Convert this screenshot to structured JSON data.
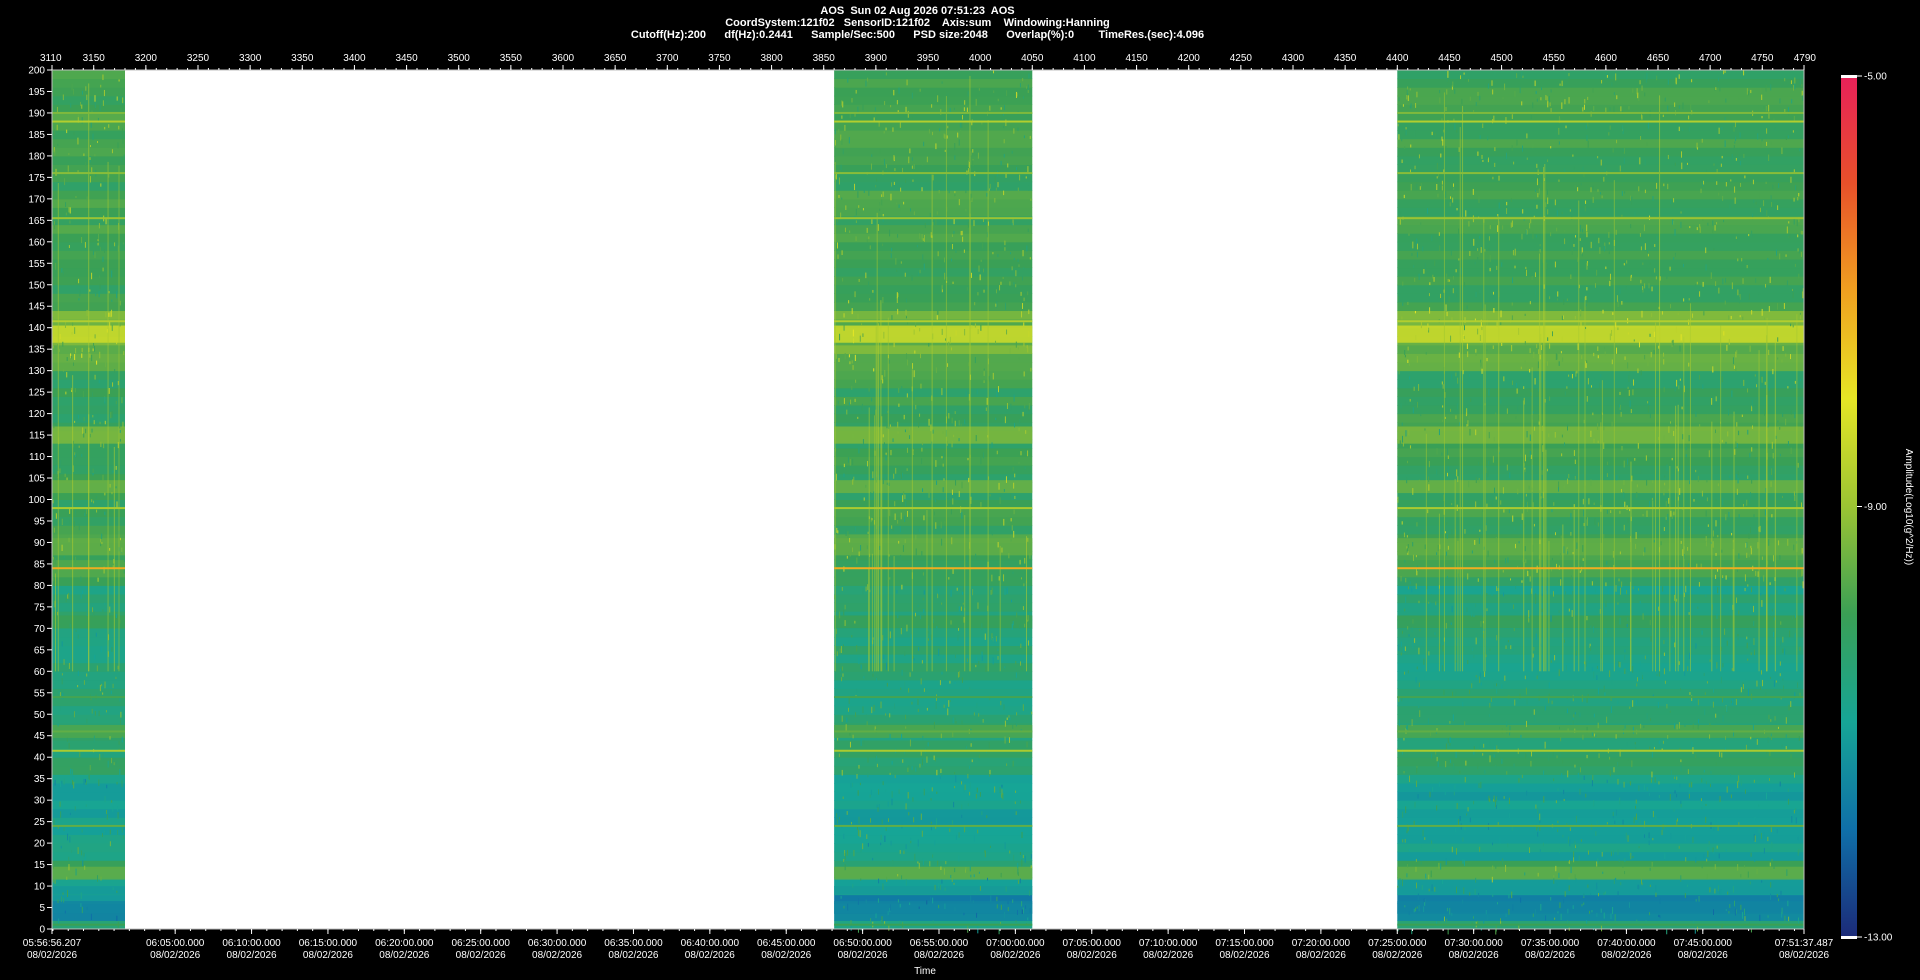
{
  "header": {
    "line1": "AOS  Sun 02 Aug 2026 07:51:23  AOS",
    "line2": "CoordSystem:121f02   SensorID:121f02    Axis:sum    Windowing:Hanning",
    "line3": "Cutoff(Hz):200      df(Hz):0.2441      Sample/Sec:500      PSD size:2048      Overlap(%):0        TimeRes.(sec):4.096"
  },
  "chart_data": {
    "type": "heatmap",
    "title": "",
    "top_axis": {
      "range": [
        3110,
        4790
      ],
      "ticks": [
        3110,
        3150,
        3200,
        3250,
        3300,
        3350,
        3400,
        3450,
        3500,
        3550,
        3600,
        3650,
        3700,
        3750,
        3800,
        3850,
        3900,
        3950,
        4000,
        4050,
        4100,
        4150,
        4200,
        4250,
        4300,
        4350,
        4400,
        4450,
        4500,
        4550,
        4600,
        4650,
        4700,
        4750,
        4790
      ]
    },
    "y_axis": {
      "label": "",
      "range": [
        0,
        200
      ],
      "ticks": [
        0,
        5,
        10,
        15,
        20,
        25,
        30,
        35,
        40,
        45,
        50,
        55,
        60,
        65,
        70,
        75,
        80,
        85,
        90,
        95,
        100,
        105,
        110,
        115,
        120,
        125,
        130,
        135,
        140,
        145,
        150,
        155,
        160,
        165,
        170,
        175,
        180,
        185,
        190,
        195,
        200
      ]
    },
    "x_axis": {
      "label": "Time",
      "ticks": [
        {
          "time": "05:56:56.207",
          "date": "08/02/2026"
        },
        {
          "time": "06:05:00.000",
          "date": "08/02/2026"
        },
        {
          "time": "06:10:00.000",
          "date": "08/02/2026"
        },
        {
          "time": "06:15:00.000",
          "date": "08/02/2026"
        },
        {
          "time": "06:20:00.000",
          "date": "08/02/2026"
        },
        {
          "time": "06:25:00.000",
          "date": "08/02/2026"
        },
        {
          "time": "06:30:00.000",
          "date": "08/02/2026"
        },
        {
          "time": "06:35:00.000",
          "date": "08/02/2026"
        },
        {
          "time": "06:40:00.000",
          "date": "08/02/2026"
        },
        {
          "time": "06:45:00.000",
          "date": "08/02/2026"
        },
        {
          "time": "06:50:00.000",
          "date": "08/02/2026"
        },
        {
          "time": "06:55:00.000",
          "date": "08/02/2026"
        },
        {
          "time": "07:00:00.000",
          "date": "08/02/2026"
        },
        {
          "time": "07:05:00.000",
          "date": "08/02/2026"
        },
        {
          "time": "07:10:00.000",
          "date": "08/02/2026"
        },
        {
          "time": "07:15:00.000",
          "date": "08/02/2026"
        },
        {
          "time": "07:20:00.000",
          "date": "08/02/2026"
        },
        {
          "time": "07:25:00.000",
          "date": "08/02/2026"
        },
        {
          "time": "07:30:00.000",
          "date": "08/02/2026"
        },
        {
          "time": "07:35:00.000",
          "date": "08/02/2026"
        },
        {
          "time": "07:40:00.000",
          "date": "08/02/2026"
        },
        {
          "time": "07:45:00.000",
          "date": "08/02/2026"
        },
        {
          "time": "07:51:37.487",
          "date": "08/02/2026"
        }
      ]
    },
    "data_segments": [
      {
        "start": 3110,
        "end": 3180
      },
      {
        "start": 3860,
        "end": 4050
      },
      {
        "start": 4400,
        "end": 4790
      }
    ],
    "gap_color": "#ffffff",
    "colorbar": {
      "label": "Amplitude(Log10(g^2/Hz))",
      "ticks": [
        -5.0,
        -9.0,
        -13.0
      ],
      "tick_labels": [
        "-5.00",
        "-9.00",
        "-13.00"
      ],
      "range": [
        -13,
        -5
      ],
      "colors": [
        "#1c2a78",
        "#0f6fa8",
        "#16a596",
        "#3aa055",
        "#9bc433",
        "#e6e625",
        "#f0a020",
        "#e8502a",
        "#e8205a"
      ]
    },
    "spectral_lines_hz": [
      {
        "freq": 1,
        "level": -10.0
      },
      {
        "freq": 24,
        "level": -9.6
      },
      {
        "freq": 41.5,
        "level": -8.8
      },
      {
        "freq": 46,
        "level": -9.6
      },
      {
        "freq": 54,
        "level": -9.9
      },
      {
        "freq": 84,
        "level": -7.2
      },
      {
        "freq": 98,
        "level": -8.8
      },
      {
        "freq": 141.5,
        "level": -8.7
      },
      {
        "freq": 165.5,
        "level": -9.0
      },
      {
        "freq": 176,
        "level": -9.2
      },
      {
        "freq": 188,
        "level": -8.7
      },
      {
        "freq": 190,
        "level": -9.3
      }
    ],
    "bands_hz": [
      {
        "center": 138.5,
        "width": 4,
        "level": -8.3
      },
      {
        "center": 115,
        "width": 4,
        "level": -9.3
      },
      {
        "center": 103,
        "width": 3,
        "level": -9.5
      },
      {
        "center": 89,
        "width": 4,
        "level": -9.6
      },
      {
        "center": 71.5,
        "width": 3,
        "level": -10.0
      },
      {
        "center": 46,
        "width": 3,
        "level": -9.8
      },
      {
        "center": 13,
        "width": 3,
        "level": -9.6
      },
      {
        "center": 9,
        "width": 2,
        "level": -11.2
      },
      {
        "center": 5,
        "width": 3,
        "level": -11.6
      }
    ]
  }
}
